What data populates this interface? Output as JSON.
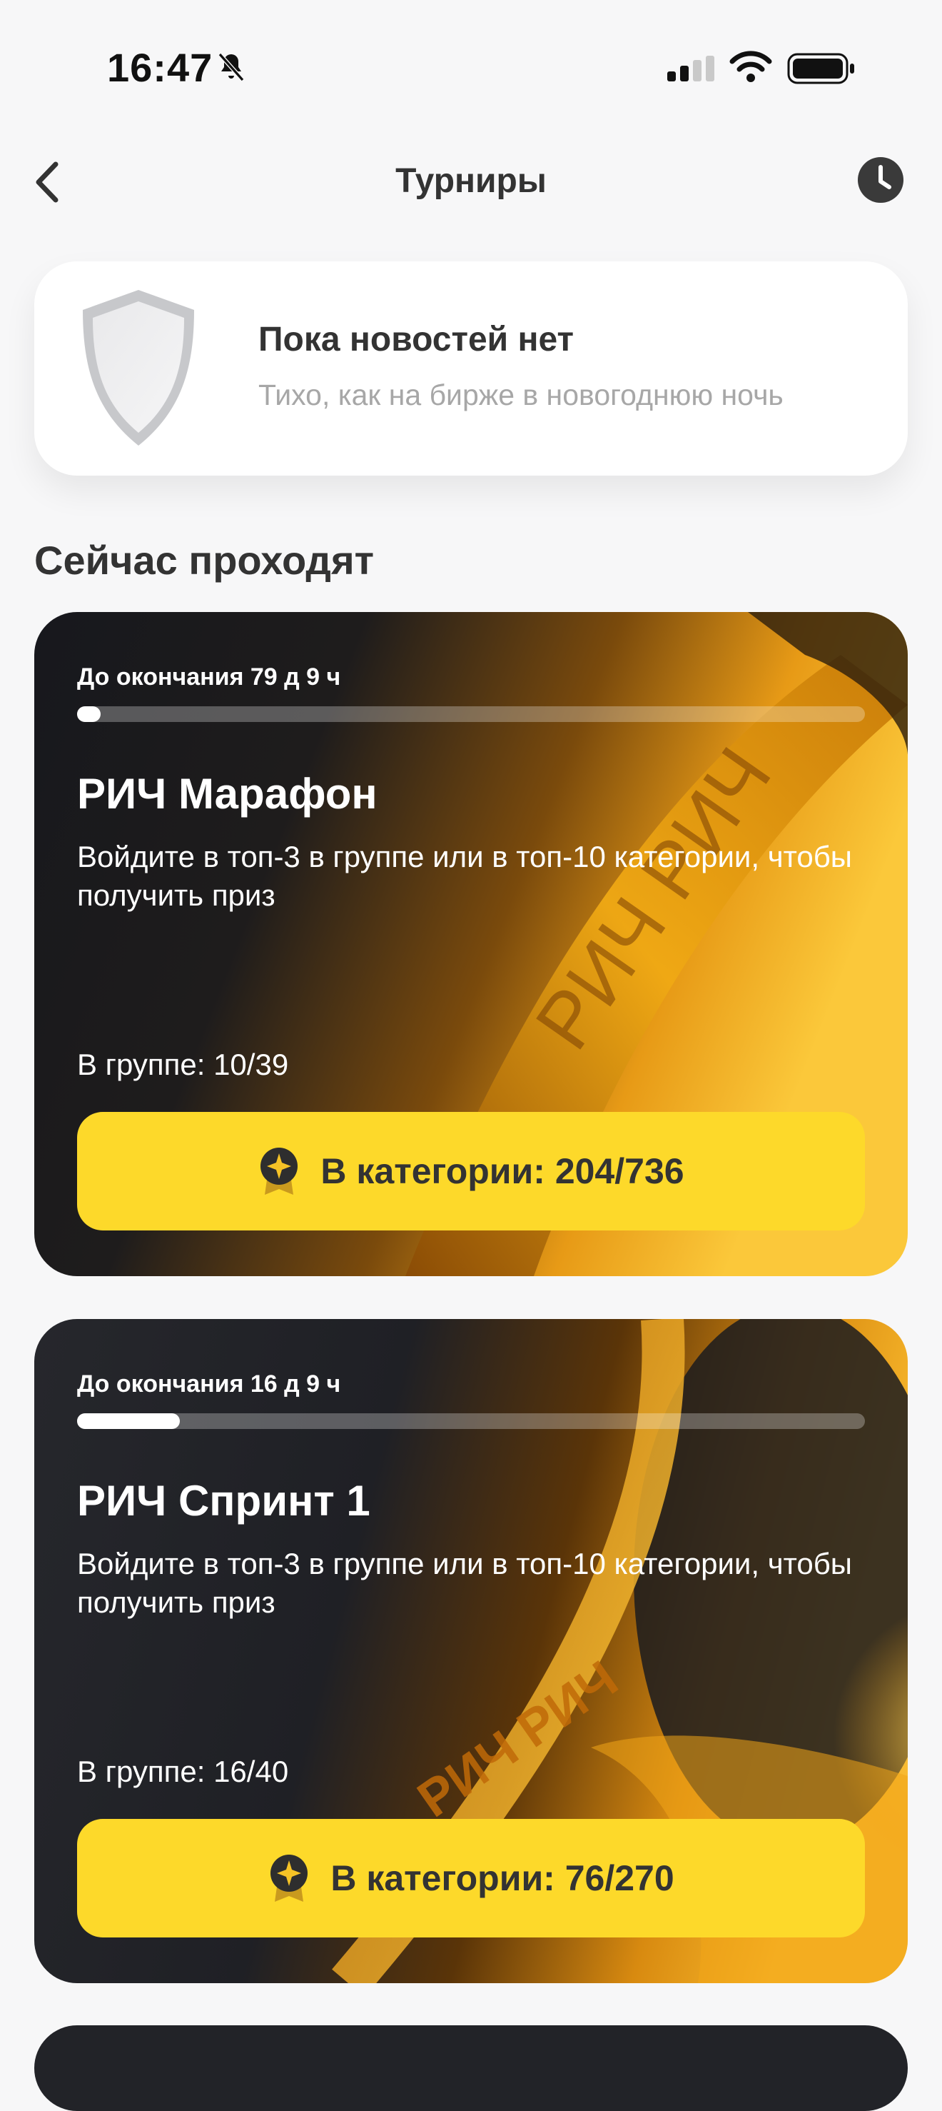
{
  "status_bar": {
    "time": "16:47"
  },
  "header": {
    "title": "Турниры"
  },
  "news": {
    "title": "Пока новостей нет",
    "subtitle": "Тихо, как на бирже в новогоднюю ночь"
  },
  "section": {
    "title": "Сейчас проходят"
  },
  "tournaments": [
    {
      "deadline": "До окончания 79 д 9 ч",
      "progress": 0.03,
      "title": "РИЧ Марафон",
      "description": "Войдите в топ-3 в группе или в топ-10 категории, чтобы получить приз",
      "group": "В группе: 10/39",
      "category_button": "В категории: 204/736",
      "bg_text": "РИЧ РИЧ"
    },
    {
      "deadline": "До окончания 16 д 9 ч",
      "progress": 0.13,
      "title": "РИЧ Спринт 1",
      "description": "Войдите в топ-3 в группе или в топ-10 категории, чтобы получить приз",
      "group": "В группе: 16/40",
      "category_button": "В категории: 76/270",
      "bg_text": "РИЧ РИЧ"
    }
  ],
  "colors": {
    "accent": "#fdd92a",
    "card_dark": "#1c1d22",
    "gold": "#f2a20c"
  },
  "icons": {
    "back": "chevron-left-icon",
    "history": "clock-icon",
    "news": "shield-icon",
    "medal": "medal-icon"
  }
}
